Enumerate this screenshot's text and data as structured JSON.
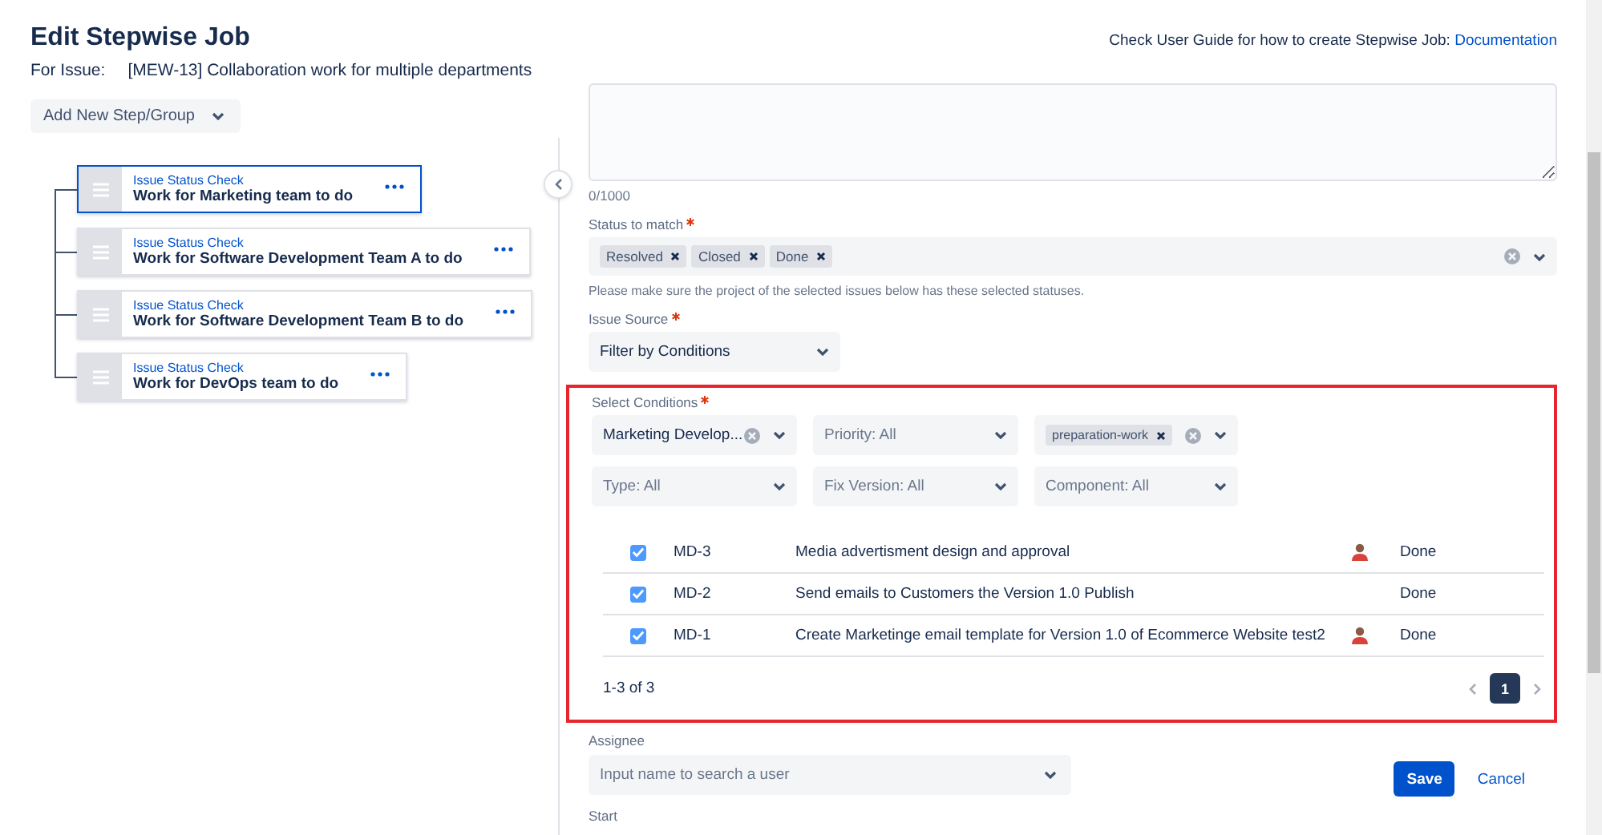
{
  "header": {
    "title": "Edit Stepwise Job",
    "issue_label": "For Issue:",
    "issue": "[MEW-13] Collaboration work for multiple departments",
    "guide_text": "Check User Guide for how to create Stepwise Job:",
    "guide_link": "Documentation"
  },
  "add_button": {
    "label": "Add New Step/Group"
  },
  "steps": [
    {
      "type": "Issue Status Check",
      "name": "Work for Marketing team to do",
      "selected": true
    },
    {
      "type": "Issue Status Check",
      "name": "Work for Software Development Team A to do",
      "selected": false
    },
    {
      "type": "Issue Status Check",
      "name": "Work for Software Development Team B to do",
      "selected": false
    },
    {
      "type": "Issue Status Check",
      "name": "Work for DevOps team to do",
      "selected": false
    }
  ],
  "form": {
    "description": {
      "counter": "0/1000"
    },
    "status_to_match": {
      "label": "Status to match",
      "required": true,
      "tags": [
        "Resolved",
        "Closed",
        "Done"
      ],
      "hint": "Please make sure the project of the selected issues below has these selected statuses."
    },
    "issue_source": {
      "label": "Issue Source",
      "required": true,
      "value": "Filter by Conditions"
    },
    "select_conditions": {
      "label": "Select Conditions",
      "required": true,
      "highlighted": true,
      "filters": [
        {
          "kind": "value",
          "value": "Marketing Develop...",
          "clearable": true
        },
        {
          "kind": "placeholder",
          "placeholder": "Priority: All",
          "clearable": false
        },
        {
          "kind": "tags",
          "tags": [
            "preparation-work"
          ],
          "clearable": true
        },
        {
          "kind": "placeholder",
          "placeholder": "Type: All",
          "clearable": false
        },
        {
          "kind": "placeholder",
          "placeholder": "Fix Version: All",
          "clearable": false
        },
        {
          "kind": "placeholder",
          "placeholder": "Component: All",
          "clearable": false
        }
      ],
      "issues": [
        {
          "checked": true,
          "key": "MD-3",
          "summary": "Media advertisment design and approval",
          "has_assignee": true,
          "status": "Done"
        },
        {
          "checked": true,
          "key": "MD-2",
          "summary": "Send emails to Customers the Version 1.0 Publish",
          "has_assignee": false,
          "status": "Done"
        },
        {
          "checked": true,
          "key": "MD-1",
          "summary": "Create Marketinge email template for Version 1.0 of Ecommerce Website test2",
          "has_assignee": true,
          "status": "Done"
        }
      ],
      "range": "1-3 of 3",
      "pages": [
        {
          "label": "1",
          "selected": true
        }
      ]
    },
    "assignee": {
      "label": "Assignee",
      "placeholder": "Input name to search a user"
    },
    "start": {
      "label": "Start"
    }
  },
  "buttons": {
    "save": "Save",
    "cancel": "Cancel"
  }
}
